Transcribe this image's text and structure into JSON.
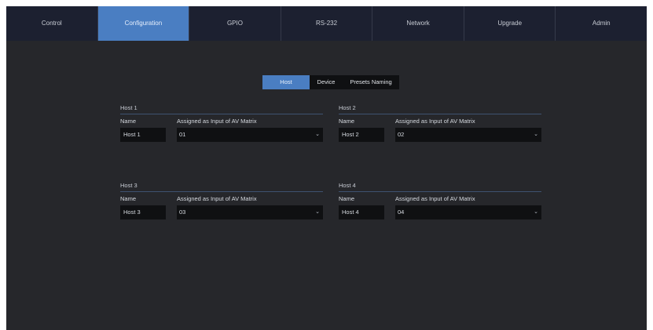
{
  "nav": {
    "tabs": [
      {
        "label": "Control"
      },
      {
        "label": "Configuration",
        "active": true
      },
      {
        "label": "GPIO"
      },
      {
        "label": "RS-232"
      },
      {
        "label": "Network"
      },
      {
        "label": "Upgrade"
      },
      {
        "label": "Admin"
      }
    ]
  },
  "subtabs": [
    {
      "label": "Host",
      "active": true
    },
    {
      "label": "Device"
    },
    {
      "label": "Presets Naming"
    }
  ],
  "hosts": [
    {
      "title": "Host 1",
      "name_label": "Name",
      "assign_label": "Assigned as Input of AV Matrix",
      "name_value": "Host 1",
      "assign_value": "01"
    },
    {
      "title": "Host 2",
      "name_label": "Name",
      "assign_label": "Assigned as Input of AV Matrix",
      "name_value": "Host 2",
      "assign_value": "02"
    },
    {
      "title": "Host 3",
      "name_label": "Name",
      "assign_label": "Assigned as Input of AV Matrix",
      "name_value": "Host 3",
      "assign_value": "03"
    },
    {
      "title": "Host 4",
      "name_label": "Name",
      "assign_label": "Assigned as Input of AV Matrix",
      "name_value": "Host 4",
      "assign_value": "04"
    }
  ],
  "icons": {
    "dropdown": "chevron-down-icon"
  },
  "colors": {
    "accent": "#4a7ec2",
    "background": "#26272b",
    "nav_background": "#1c2030",
    "field_background": "#0f1012"
  }
}
